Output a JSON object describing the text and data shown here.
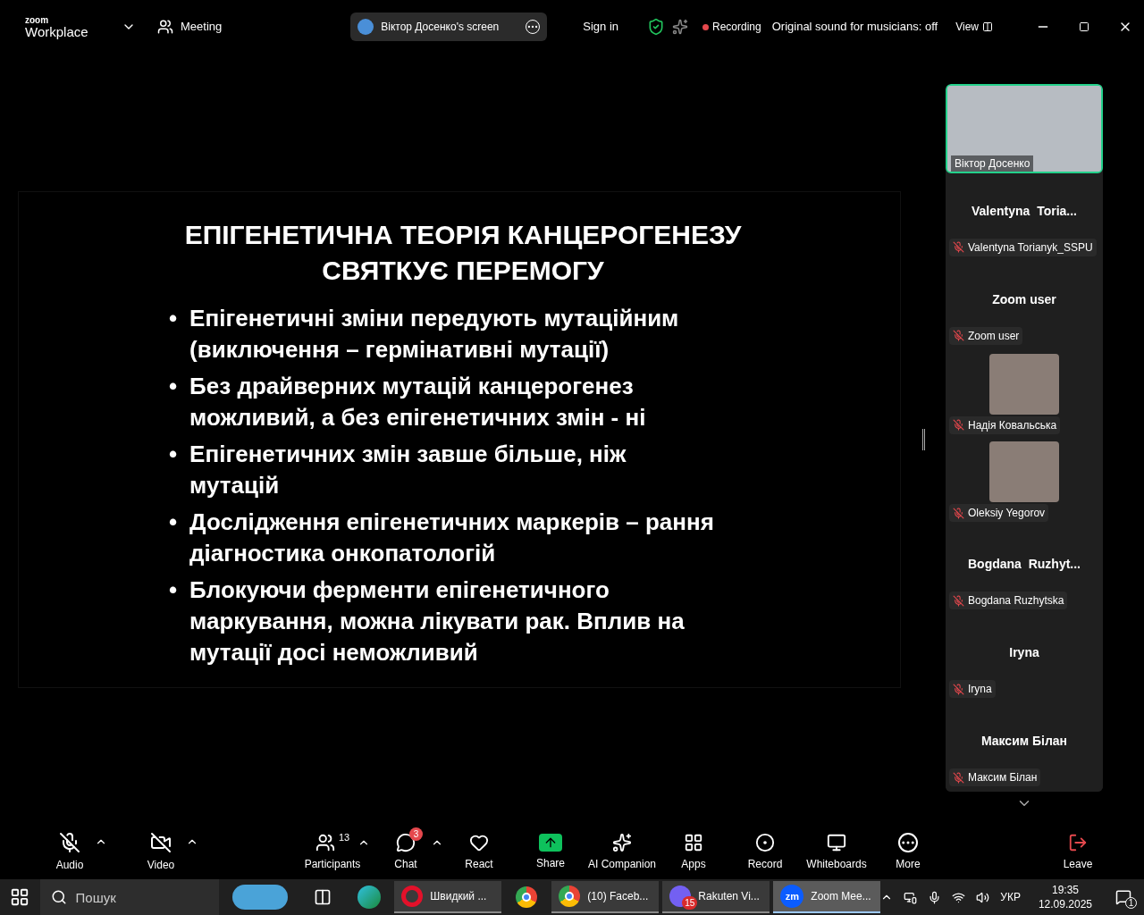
{
  "top_bar": {
    "logo_small": "zoom",
    "logo_large": "Workplace",
    "meeting_label": "Meeting",
    "share_pill": "Віктор Досенко's screen",
    "sign_in": "Sign in",
    "recording": "Recording",
    "original_sound": "Original sound for musicians: off",
    "view": "View"
  },
  "slide": {
    "title_lines": [
      "ЕПІГЕНЕТИЧНА ТЕОРІЯ КАНЦЕРОГЕНЕЗУ",
      "СВЯТКУЄ ПЕРЕМОГУ"
    ],
    "bullets": [
      {
        "bullet": "•",
        "text": "Епігенетичні зміни передують мутаційним (виключення – гермінативні мутації)"
      },
      {
        "bullet": "•",
        "text": "Без драйверних мутацій канцерогенез можливий, а без епігенетичних змін - ні"
      },
      {
        "bullet": "•",
        "text": "Епігенетичних змін завше більше, ніж мутацій"
      },
      {
        "bullet": "•",
        "text": "Дослідження епігенетичних маркерів – рання діагностика онкопатологій"
      },
      {
        "bullet": "•",
        "text": "Блокуючи ферменти епігенетичного маркування, можна лікувати рак. Вплив на мутації досі неможливий"
      }
    ]
  },
  "participants": [
    {
      "kind": "video",
      "label": "Віктор Досенко",
      "active_speaker": true
    },
    {
      "kind": "name",
      "display": "Valentyna  Toria...",
      "label": "Valentyna Torianyk_SSPU",
      "muted": true
    },
    {
      "kind": "name",
      "display": "Zoom user",
      "label": "Zoom user",
      "muted": true
    },
    {
      "kind": "photo",
      "label": "Надія Ковальська",
      "muted": true
    },
    {
      "kind": "photo",
      "label": "Oleksiy Yegorov",
      "muted": true
    },
    {
      "kind": "name",
      "display": "Bogdana  Ruzhyt...",
      "label": "Bogdana Ruzhytska",
      "muted": true
    },
    {
      "kind": "name",
      "display": "Iryna",
      "label": "Iryna",
      "muted": true
    },
    {
      "kind": "name",
      "display": "Максим Білан",
      "label": "Максим Білан",
      "muted": true
    }
  ],
  "toolbar": [
    {
      "kind": "audio",
      "label": "Audio",
      "off": true,
      "caret": true
    },
    {
      "kind": "video",
      "label": "Video",
      "off": true,
      "caret": true
    },
    {
      "kind": "participants",
      "label": "Participants",
      "count": "13",
      "caret": true
    },
    {
      "kind": "chat",
      "label": "Chat",
      "badge": "3",
      "caret": true
    },
    {
      "kind": "react",
      "label": "React"
    },
    {
      "kind": "share",
      "label": "Share"
    },
    {
      "kind": "ai",
      "label": "AI Companion"
    },
    {
      "kind": "apps",
      "label": "Apps"
    },
    {
      "kind": "record",
      "label": "Record"
    },
    {
      "kind": "whiteboards",
      "label": "Whiteboards"
    },
    {
      "kind": "more",
      "label": "More"
    },
    {
      "kind": "leave",
      "label": "Leave"
    }
  ],
  "taskbar": {
    "search_placeholder": "Пошук",
    "apps": [
      {
        "kind": "taskview"
      },
      {
        "kind": "edge"
      },
      {
        "kind": "opera",
        "label": "Швидкий ...",
        "selected": false
      },
      {
        "kind": "chrome"
      },
      {
        "kind": "chrome",
        "label": "(10) Faceb...",
        "selected": false
      },
      {
        "kind": "viber",
        "label": "Rakuten Vi...",
        "badge": "15",
        "selected": false
      },
      {
        "kind": "zoom",
        "label": "Zoom Mee...",
        "icon_text": "zm",
        "selected": true
      }
    ],
    "language": "УКР",
    "time": "19:35",
    "date": "12.09.2025",
    "notifications": "1"
  }
}
